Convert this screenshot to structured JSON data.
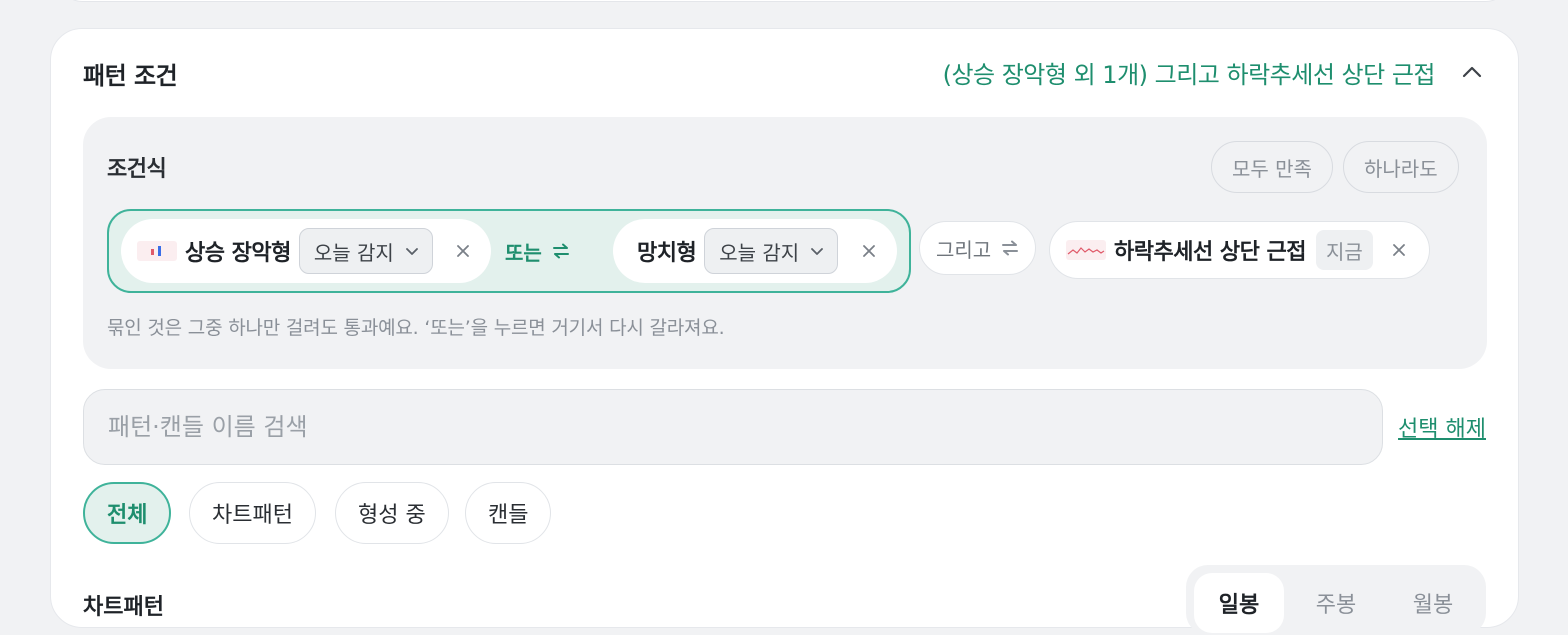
{
  "pattern_conditions": {
    "title": "패턴 조건",
    "summary": "(상승 장악형 외 1개) 그리고 하락추세선 상단 근접",
    "expression": {
      "title": "조건식",
      "mode_all": "모두 만족",
      "mode_any": "하나라도",
      "group": {
        "chip1_label": "상승 장악형",
        "chip1_timing": "오늘 감지",
        "or_label": "또는",
        "chip2_label": "망치형",
        "chip2_timing": "오늘 감지"
      },
      "and_label": "그리고",
      "chip3_label": "하락추세선 상단 근접",
      "chip3_badge": "지금",
      "hint": "묶인 것은 그중 하나만 걸려도 통과예요. ‘또는’을 누르면 거기서 다시 갈라져요."
    },
    "search": {
      "placeholder": "패턴·캔들 이름 검색",
      "value": ""
    },
    "deselect_label": "선택 해제",
    "filters": [
      "전체",
      "차트패턴",
      "형성 중",
      "캔들"
    ],
    "active_filter": "전체",
    "section_title": "차트패턴",
    "periods": [
      "일봉",
      "주봉",
      "월봉"
    ],
    "active_period": "일봉"
  },
  "colors": {
    "accent": "#1e8e6e",
    "accent_border": "#3fb39a",
    "accent_bg": "#e3f1ed",
    "muted_text": "#8a9098"
  },
  "icons": {
    "collapse": "chevron-up-icon",
    "dropdown": "chevron-down-icon",
    "remove": "close-icon",
    "swap": "swap-arrows-icon"
  }
}
